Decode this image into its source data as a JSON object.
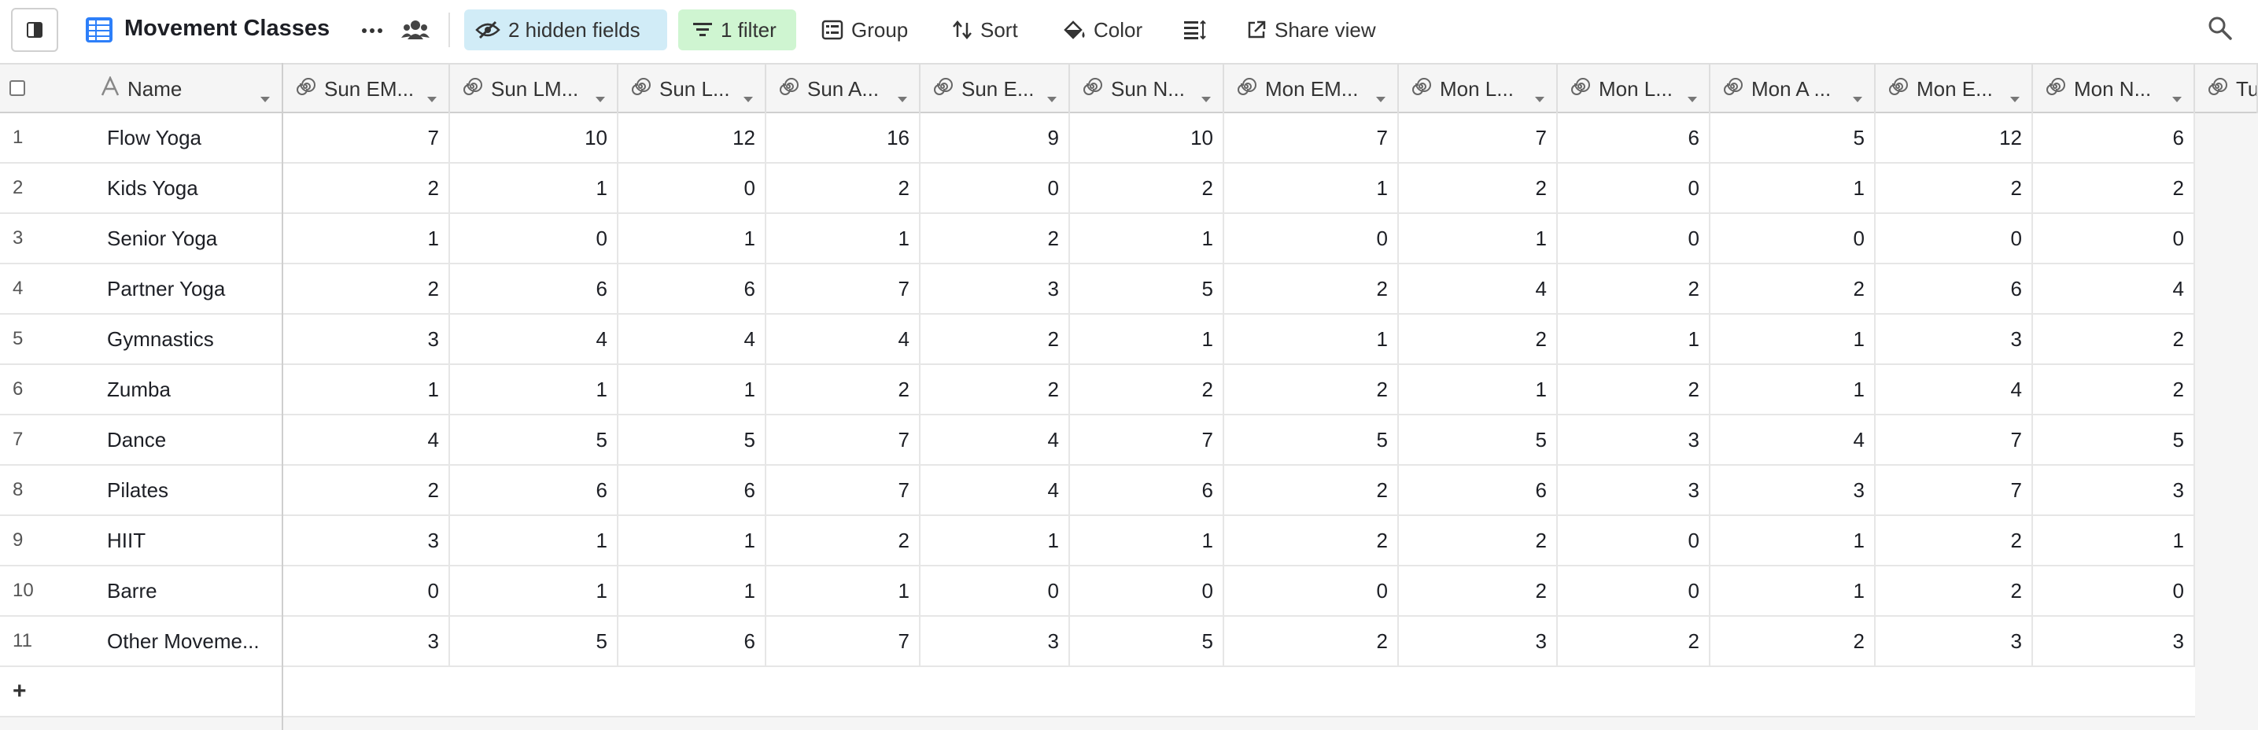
{
  "toolbar": {
    "view_title": "Movement Classes",
    "hidden_fields_label": "2 hidden fields",
    "filter_label": "1 filter",
    "group_label": "Group",
    "sort_label": "Sort",
    "color_label": "Color",
    "share_label": "Share view",
    "colors": {
      "hidden_bg": "#d1ecf7",
      "filter_bg": "#cff5d1",
      "view_icon": "#2d7ff9"
    }
  },
  "columns": [
    {
      "key": "name",
      "label": "Name",
      "icon": "text-field-icon"
    },
    {
      "key": "c1",
      "label": "Sun EM...",
      "icon": "rollup-icon"
    },
    {
      "key": "c2",
      "label": "Sun LM...",
      "icon": "rollup-icon"
    },
    {
      "key": "c3",
      "label": "Sun L...",
      "icon": "rollup-icon"
    },
    {
      "key": "c4",
      "label": "Sun A...",
      "icon": "rollup-icon"
    },
    {
      "key": "c5",
      "label": "Sun E...",
      "icon": "rollup-icon"
    },
    {
      "key": "c6",
      "label": "Sun N...",
      "icon": "rollup-icon"
    },
    {
      "key": "c7",
      "label": "Mon EM...",
      "icon": "rollup-icon"
    },
    {
      "key": "c8",
      "label": "Mon L...",
      "icon": "rollup-icon"
    },
    {
      "key": "c9",
      "label": "Mon L...",
      "icon": "rollup-icon"
    },
    {
      "key": "c10",
      "label": "Mon A ...",
      "icon": "rollup-icon"
    },
    {
      "key": "c11",
      "label": "Mon E...",
      "icon": "rollup-icon"
    },
    {
      "key": "c12",
      "label": "Mon N...",
      "icon": "rollup-icon"
    },
    {
      "key": "c13",
      "label": "Tu",
      "icon": "rollup-icon"
    }
  ],
  "rows": [
    {
      "num": "1",
      "name": "Flow Yoga",
      "values": [
        "7",
        "10",
        "12",
        "16",
        "9",
        "10",
        "7",
        "7",
        "6",
        "5",
        "12",
        "6"
      ]
    },
    {
      "num": "2",
      "name": "Kids Yoga",
      "values": [
        "2",
        "1",
        "0",
        "2",
        "0",
        "2",
        "1",
        "2",
        "0",
        "1",
        "2",
        "2"
      ]
    },
    {
      "num": "3",
      "name": "Senior Yoga",
      "values": [
        "1",
        "0",
        "1",
        "1",
        "2",
        "1",
        "0",
        "1",
        "0",
        "0",
        "0",
        "0"
      ]
    },
    {
      "num": "4",
      "name": "Partner Yoga",
      "values": [
        "2",
        "6",
        "6",
        "7",
        "3",
        "5",
        "2",
        "4",
        "2",
        "2",
        "6",
        "4"
      ]
    },
    {
      "num": "5",
      "name": "Gymnastics",
      "values": [
        "3",
        "4",
        "4",
        "4",
        "2",
        "1",
        "1",
        "2",
        "1",
        "1",
        "3",
        "2"
      ]
    },
    {
      "num": "6",
      "name": "Zumba",
      "values": [
        "1",
        "1",
        "1",
        "2",
        "2",
        "2",
        "2",
        "1",
        "2",
        "1",
        "4",
        "2"
      ]
    },
    {
      "num": "7",
      "name": "Dance",
      "values": [
        "4",
        "5",
        "5",
        "7",
        "4",
        "7",
        "5",
        "5",
        "3",
        "4",
        "7",
        "5"
      ]
    },
    {
      "num": "8",
      "name": "Pilates",
      "values": [
        "2",
        "6",
        "6",
        "7",
        "4",
        "6",
        "2",
        "6",
        "3",
        "3",
        "7",
        "3"
      ]
    },
    {
      "num": "9",
      "name": "HIIT",
      "values": [
        "3",
        "1",
        "1",
        "2",
        "1",
        "1",
        "2",
        "2",
        "0",
        "1",
        "2",
        "1"
      ]
    },
    {
      "num": "10",
      "name": "Barre",
      "values": [
        "0",
        "1",
        "1",
        "1",
        "0",
        "0",
        "0",
        "2",
        "0",
        "1",
        "2",
        "0"
      ]
    },
    {
      "num": "11",
      "name": "Other Moveme...",
      "values": [
        "3",
        "5",
        "6",
        "7",
        "3",
        "5",
        "2",
        "3",
        "2",
        "2",
        "3",
        "3"
      ]
    }
  ],
  "add_row_label": "+"
}
